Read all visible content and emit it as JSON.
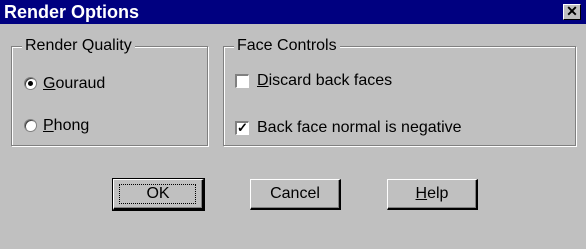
{
  "window": {
    "title": "Render Options",
    "close_glyph": "✕"
  },
  "render_quality": {
    "label": "Render Quality",
    "options": [
      {
        "label_first": "G",
        "label_rest": "ouraud",
        "selected": true
      },
      {
        "label_first": "P",
        "label_rest": "hong",
        "selected": false
      }
    ]
  },
  "face_controls": {
    "label": "Face Controls",
    "options": [
      {
        "label_first": "D",
        "label_rest": "iscard back faces",
        "checked": false
      },
      {
        "label_first": "",
        "label_rest": "Back face normal is negative",
        "checked": true
      }
    ]
  },
  "buttons": {
    "ok": "OK",
    "cancel": "Cancel",
    "help_first": "H",
    "help_rest": "elp"
  },
  "icons": {
    "check": "✓",
    "close": "close-icon"
  }
}
